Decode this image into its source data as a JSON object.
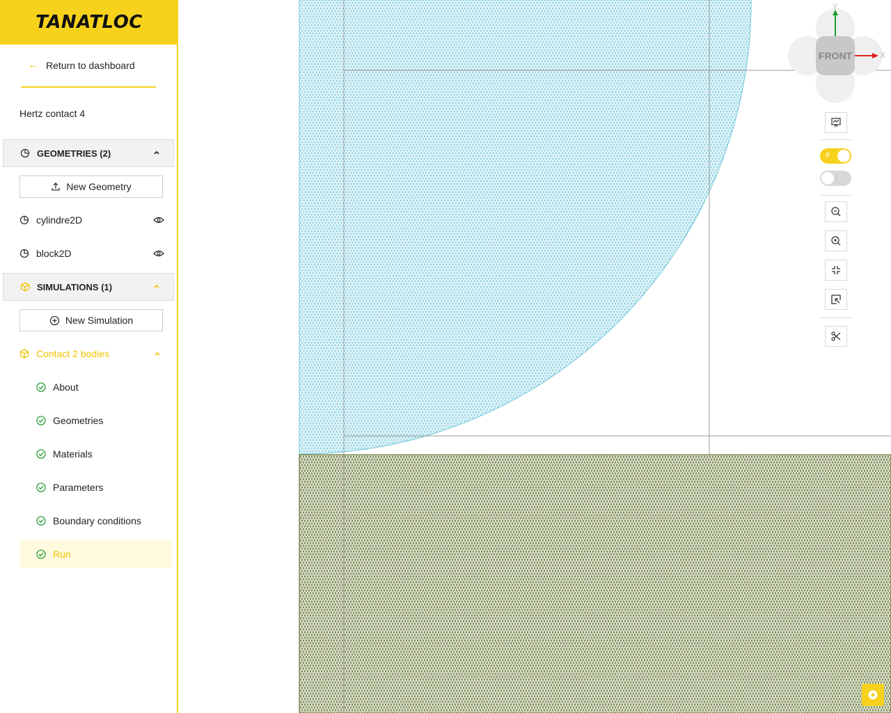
{
  "brand": {
    "name": "TANATLOC"
  },
  "nav": {
    "back_label": "Return to dashboard"
  },
  "project": {
    "name": "Hertz contact 4"
  },
  "geometries": {
    "header": "GEOMETRIES (2)",
    "new_label": "New Geometry",
    "items": [
      {
        "label": "cylindre2D"
      },
      {
        "label": "block2D"
      }
    ]
  },
  "simulations": {
    "header": "SIMULATIONS (1)",
    "new_label": "New Simulation",
    "items": [
      {
        "label": "Contact 2 bodies",
        "steps": [
          {
            "label": "About",
            "status": "done"
          },
          {
            "label": "Geometries",
            "status": "done"
          },
          {
            "label": "Materials",
            "status": "done"
          },
          {
            "label": "Parameters",
            "status": "done"
          },
          {
            "label": "Boundary conditions",
            "status": "done"
          },
          {
            "label": "Run",
            "status": "done",
            "active": true
          }
        ]
      }
    ]
  },
  "viewer": {
    "view_label": "FRONT",
    "axis_x": "X",
    "axis_y": "Y",
    "toggles": [
      {
        "name": "grid",
        "on": true
      },
      {
        "name": "result",
        "on": false
      }
    ],
    "colors": {
      "accent": "#f7d21c",
      "cylinder_mesh": "#5bc0d8",
      "block_mesh": "#556b1e",
      "x_axis": "#e02020",
      "y_axis": "#1e9c2e"
    }
  }
}
